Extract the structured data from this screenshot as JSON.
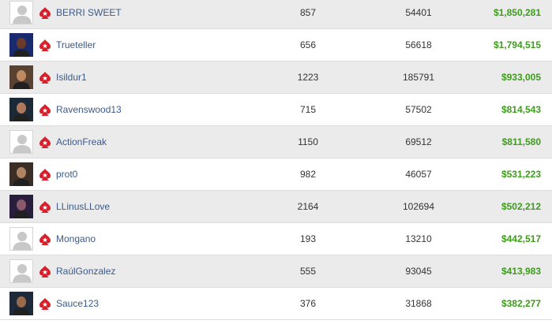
{
  "colors": {
    "row_alt": "#ebebeb",
    "row_plain": "#ffffff",
    "name": "#3b5a8a",
    "money": "#3d9c1c",
    "brand": "#d6202b"
  },
  "rows": [
    {
      "name": "BERRI SWEET",
      "col_a": "857",
      "col_b": "54401",
      "money": "$1,850,281",
      "avatar": "placeholder",
      "photo_colors": [
        "#ffffff",
        "#d4d4d4"
      ]
    },
    {
      "name": "Trueteller",
      "col_a": "656",
      "col_b": "56618",
      "money": "$1,794,515",
      "avatar": "photo",
      "photo_colors": [
        "#1a2a6e",
        "#6a3c2a"
      ]
    },
    {
      "name": "Isildur1",
      "col_a": "1223",
      "col_b": "185791",
      "money": "$933,005",
      "avatar": "photo",
      "photo_colors": [
        "#5a4232",
        "#c08a60"
      ]
    },
    {
      "name": "Ravenswood13",
      "col_a": "715",
      "col_b": "57502",
      "money": "$814,543",
      "avatar": "photo",
      "photo_colors": [
        "#1c2a38",
        "#b07a5a"
      ]
    },
    {
      "name": "ActionFreak",
      "col_a": "1150",
      "col_b": "69512",
      "money": "$811,580",
      "avatar": "placeholder",
      "photo_colors": [
        "#ffffff",
        "#d4d4d4"
      ]
    },
    {
      "name": "prot0",
      "col_a": "982",
      "col_b": "46057",
      "money": "$531,223",
      "avatar": "photo",
      "photo_colors": [
        "#3a2e26",
        "#b08462"
      ]
    },
    {
      "name": "LLinusLLove",
      "col_a": "2164",
      "col_b": "102694",
      "money": "$502,212",
      "avatar": "photo",
      "photo_colors": [
        "#2a1e3e",
        "#8a5a6a"
      ]
    },
    {
      "name": "Mongano",
      "col_a": "193",
      "col_b": "13210",
      "money": "$442,517",
      "avatar": "placeholder",
      "photo_colors": [
        "#ffffff",
        "#d4d4d4"
      ]
    },
    {
      "name": "RaúlGonzalez",
      "col_a": "555",
      "col_b": "93045",
      "money": "$413,983",
      "avatar": "placeholder",
      "photo_colors": [
        "#ffffff",
        "#d4d4d4"
      ]
    },
    {
      "name": "Sauce123",
      "col_a": "376",
      "col_b": "31868",
      "money": "$382,277",
      "avatar": "photo",
      "photo_colors": [
        "#1e2a3a",
        "#9a6a4a"
      ]
    }
  ]
}
